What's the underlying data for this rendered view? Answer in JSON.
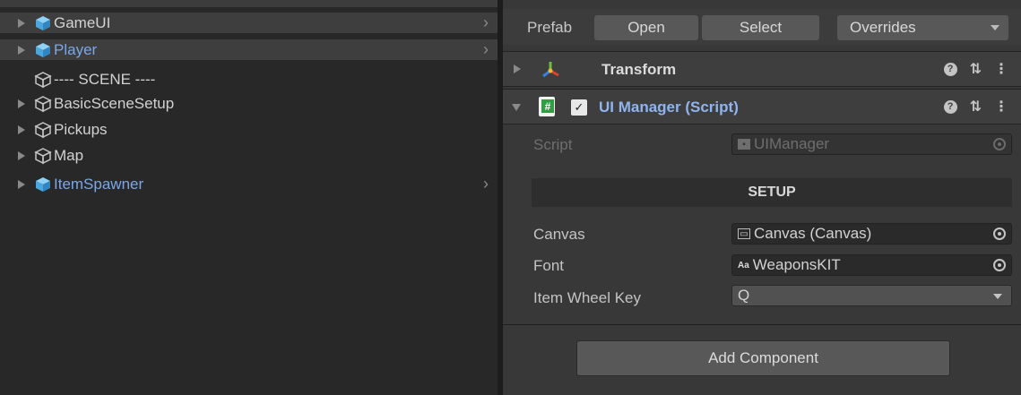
{
  "hierarchy": {
    "items": [
      {
        "label": "GameUI",
        "type": "prefab",
        "has_children": true
      },
      {
        "label": "Player",
        "type": "prefab",
        "has_children": true
      },
      {
        "label": "---- SCENE ----",
        "type": "gameobject",
        "has_children": false
      },
      {
        "label": "BasicSceneSetup",
        "type": "gameobject",
        "has_children": true
      },
      {
        "label": "Pickups",
        "type": "gameobject",
        "has_children": true
      },
      {
        "label": "Map",
        "type": "gameobject",
        "has_children": true
      },
      {
        "label": "ItemSpawner",
        "type": "prefab",
        "has_children": true
      }
    ]
  },
  "inspector": {
    "prefab_bar": {
      "label": "Prefab",
      "open": "Open",
      "select": "Select",
      "overrides": "Overrides"
    },
    "transform": {
      "title": "Transform"
    },
    "script_component": {
      "title": "UI Manager (Script)",
      "enabled": true,
      "script_label": "Script",
      "script_value": "UIManager",
      "section_header": "SETUP",
      "fields": [
        {
          "label": "Canvas",
          "value": "Canvas (Canvas)",
          "icon": "canvas-icon"
        },
        {
          "label": "Font",
          "value": "WeaponsKIT",
          "icon": "font-icon"
        },
        {
          "label": "Item Wheel Key",
          "value": "Q"
        }
      ]
    },
    "add_component": "Add Component"
  },
  "colors": {
    "prefab_text": "#7ba7e8",
    "script_title": "#8fb4f0",
    "panel_bg": "#383838",
    "hierarchy_bg": "#282828",
    "prefab_cube": "#5fb6e8"
  }
}
